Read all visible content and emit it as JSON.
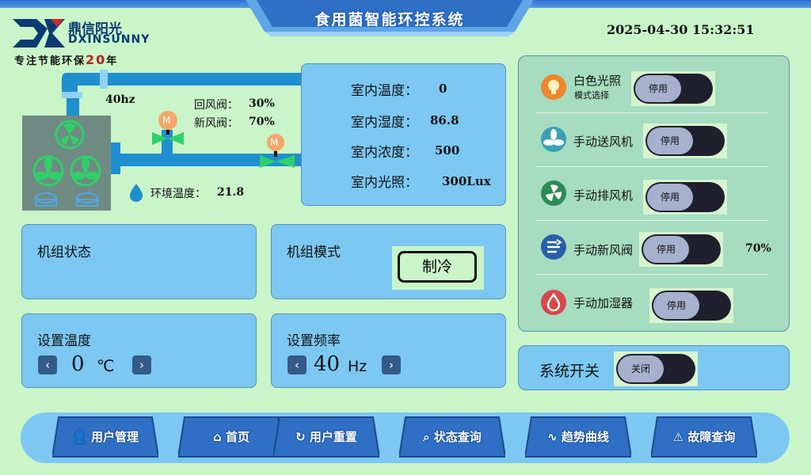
{
  "header": {
    "title": "食用菌智能环控系统",
    "datetime": "2025-04-30 15:32:51"
  },
  "logo": {
    "name_cn": "鼎信阳光",
    "name_en": "DXINSUNNY",
    "slogan_prefix": "专注节能环保",
    "slogan_years": "20",
    "slogan_suffix": "年"
  },
  "unit_diagram": {
    "freq_reading": "40hz",
    "return_valve_label": "回风阀：",
    "return_valve_value": "30%",
    "fresh_valve_label": "新风阀：",
    "fresh_valve_value": "70%",
    "valve_motor_label": "M",
    "ambient_temp_label": "环境温度：",
    "ambient_temp_value": "21.8"
  },
  "indoor": {
    "temp_label": "室内温度：",
    "temp_value": "0",
    "humidity_label": "室内湿度：",
    "humidity_value": "86.8",
    "concentration_label": "室内浓度：",
    "concentration_value": "500",
    "light_label": "室内光照：",
    "light_value": "300Lux"
  },
  "unit_status": {
    "label": "机组状态"
  },
  "unit_mode": {
    "label": "机组模式",
    "value": "制冷"
  },
  "set_temp": {
    "label": "设置温度",
    "value": "0",
    "unit": "℃",
    "dec": "‹",
    "inc": "›"
  },
  "set_freq": {
    "label": "设置频率",
    "value": "40",
    "unit": "Hz",
    "dec": "‹",
    "inc": "›"
  },
  "devices": {
    "white_light": {
      "label": "白色光照",
      "sublabel": "模式选择",
      "state": "停用",
      "color": "#f0872a"
    },
    "supply_fan": {
      "label": "手动送风机",
      "state": "停用",
      "color": "#3aa0b8"
    },
    "exhaust_fan": {
      "label": "手动排风机",
      "state": "停用",
      "color": "#2c8a55"
    },
    "fresh_valve": {
      "label": "手动新风阀",
      "state": "停用",
      "value": "70%",
      "color": "#2a5ea8"
    },
    "humidifier": {
      "label": "手动加湿器",
      "state": "停用",
      "color": "#d8484a"
    }
  },
  "system_switch": {
    "label": "系统开关",
    "state": "关闭"
  },
  "nav": [
    {
      "label": "用户管理",
      "icon": "user-icon"
    },
    {
      "label": "首页",
      "icon": "home-icon"
    },
    {
      "label": "用户重置",
      "icon": "reset-icon"
    },
    {
      "label": "状态查询",
      "icon": "search-icon"
    },
    {
      "label": "趋势曲线",
      "icon": "trend-icon"
    },
    {
      "label": "故障查询",
      "icon": "warning-icon"
    }
  ]
}
